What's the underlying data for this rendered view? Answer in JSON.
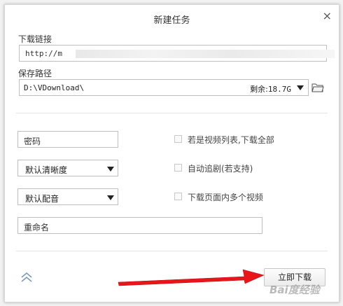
{
  "dialog": {
    "title": "新建任务",
    "close_label": "×"
  },
  "link": {
    "label": "下载链接",
    "value": "http://m"
  },
  "save_path": {
    "label": "保存路径",
    "value": "D:\\VDownload\\",
    "remaining_label": "剩余:",
    "remaining_value": "18.7G"
  },
  "options": {
    "password_placeholder": "密码",
    "resolution": "默认清晰度",
    "audio": "默认配音",
    "rename_placeholder": "重命名",
    "checkboxes": [
      {
        "label": "若是视频列表,下载全部",
        "checked": false
      },
      {
        "label": "自动追剧(若支持)",
        "checked": false
      },
      {
        "label": "下载页面内多个视频",
        "checked": false
      }
    ]
  },
  "footer": {
    "download_label": "立即下载",
    "watermark": "Bai度经验"
  },
  "colors": {
    "annotation_arrow": "#e8161a"
  }
}
